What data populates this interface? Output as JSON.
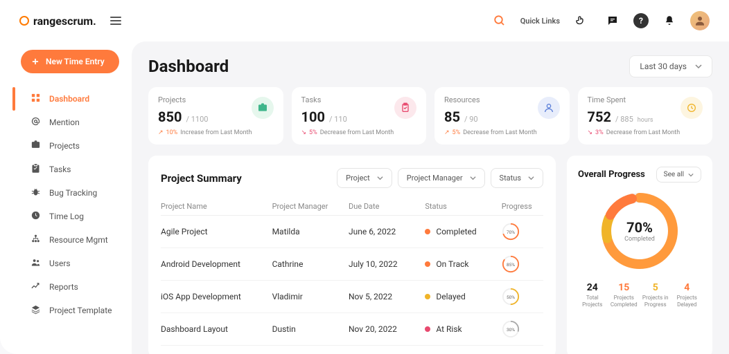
{
  "brand": "rangescrum.",
  "topbar": {
    "quick_links": "Quick Links"
  },
  "sidebar": {
    "new_btn": "New Time Entry",
    "items": [
      {
        "label": "Dashboard",
        "icon": "grid",
        "active": true
      },
      {
        "label": "Mention",
        "icon": "at"
      },
      {
        "label": "Projects",
        "icon": "briefcase"
      },
      {
        "label": "Tasks",
        "icon": "clipboard"
      },
      {
        "label": "Bug Tracking",
        "icon": "bug"
      },
      {
        "label": "Time Log",
        "icon": "clock"
      },
      {
        "label": "Resource Mgmt",
        "icon": "tree"
      },
      {
        "label": "Users",
        "icon": "users"
      },
      {
        "label": "Reports",
        "icon": "trend"
      },
      {
        "label": "Project Template",
        "icon": "layers"
      }
    ]
  },
  "page": {
    "title": "Dashboard",
    "period": "Last 30 days"
  },
  "stats": [
    {
      "label": "Projects",
      "value": "850",
      "total": "/ 1100",
      "dir": "up",
      "pct": "10%",
      "note": "Increase from Last Month",
      "icon": "briefcase",
      "cls": "ic-green",
      "color": "#3fb68b"
    },
    {
      "label": "Tasks",
      "value": "100",
      "total": "/ 110",
      "dir": "down",
      "pct": "5%",
      "note": "Decrease from Last Month",
      "icon": "clipboard",
      "cls": "ic-pink",
      "color": "#e84a6f"
    },
    {
      "label": "Resources",
      "value": "85",
      "total": "/ 90",
      "dir": "up",
      "pct": "5%",
      "note": "Decrease from Last Month",
      "icon": "user",
      "cls": "ic-blue",
      "color": "#5b7fd9"
    },
    {
      "label": "Time Spent",
      "value": "752",
      "total": "/ 885",
      "unit": "hours",
      "dir": "down",
      "pct": "3%",
      "note": "Decrease from Last Month",
      "icon": "clock",
      "cls": "ic-yellow",
      "color": "#f0b429"
    }
  ],
  "summary": {
    "title": "Project Summary",
    "filters": [
      "Project",
      "Project Manager",
      "Status"
    ],
    "columns": [
      "Project Name",
      "Project Manager",
      "Due Date",
      "Status",
      "Progress"
    ],
    "rows": [
      {
        "name": "Agile Project",
        "mgr": "Matilda",
        "date": "June 6, 2022",
        "status": "Completed",
        "dot": "#ff7a3c",
        "prog": 70,
        "color": "#ff7a3c"
      },
      {
        "name": "Android Development",
        "mgr": "Cathrine",
        "date": "July 10, 2022",
        "status": "On Track",
        "dot": "#ff7a3c",
        "prog": 85,
        "color": "#ff7a3c"
      },
      {
        "name": "iOS App Development",
        "mgr": "Vladimir",
        "date": "Nov 5, 2022",
        "status": "Delayed",
        "dot": "#f0b429",
        "prog": 50,
        "color": "#f0b429"
      },
      {
        "name": "Dashboard Layout",
        "mgr": "Dustin",
        "date": "Nov 20, 2022",
        "status": "At Risk",
        "dot": "#e84a6f",
        "prog": 30,
        "color": "#aaa"
      }
    ]
  },
  "overall": {
    "title": "Overall Progress",
    "see_all": "See all",
    "percent": 70,
    "percent_label": "70%",
    "completed_label": "Completed",
    "stats": [
      {
        "num": "24",
        "label": "Total Projects",
        "cls": "c-black"
      },
      {
        "num": "15",
        "label": "Projects Completed",
        "cls": "c-orange"
      },
      {
        "num": "5",
        "label": "Projects in Progress",
        "cls": "c-yellow"
      },
      {
        "num": "4",
        "label": "Projects Delayed",
        "cls": "c-orange"
      }
    ]
  }
}
